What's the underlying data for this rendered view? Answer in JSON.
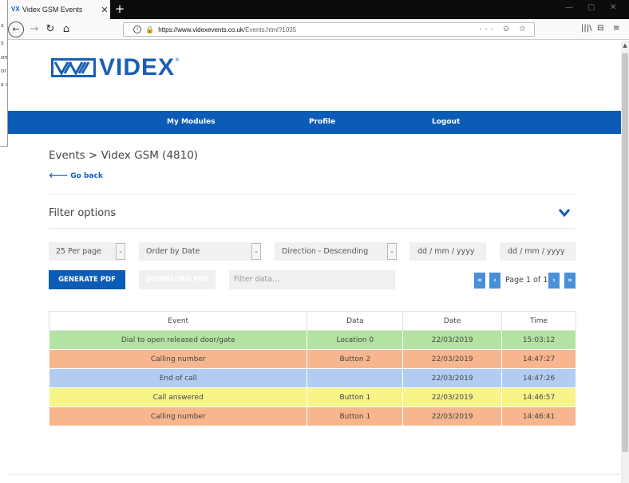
{
  "background_window": {
    "lines": [
      "s",
      "s",
      "on",
      "or",
      "s c"
    ]
  },
  "browser": {
    "tab_title": "Videx GSM Events",
    "tab_close": "✕",
    "new_tab": "+",
    "url_domain": "https://www.videxevents.co.uk",
    "url_path": "/Events.html?1035",
    "url_actions": "··· ☺ ☆",
    "library": "|||\\",
    "sidebar": "⊟",
    "menu": "≡",
    "window_controls": [
      "—",
      "▢",
      "✕"
    ]
  },
  "site": {
    "logo_text": "VIDEX",
    "logo_reg": "®"
  },
  "nav": {
    "items": [
      "My Modules",
      "Profile",
      "Logout"
    ]
  },
  "page": {
    "breadcrumb": "Events > Videx GSM (4810)",
    "go_back": "Go back",
    "filter_title": "Filter options"
  },
  "filters": {
    "per_page": "25 Per page",
    "order_by": "Order by Date",
    "direction": "Direction - Descending",
    "date_from_placeholder": "dd / mm / yyyy",
    "date_to_placeholder": "dd / mm / yyyy",
    "generate_pdf": "GENERATE PDF",
    "download_pdf": "DOWNLOAD PDF",
    "filter_placeholder": "Filter data..."
  },
  "pagination": {
    "first": "«",
    "prev": "‹",
    "label": "Page 1 of 1",
    "next": "›",
    "last": "»"
  },
  "table": {
    "headers": [
      "Event",
      "Data",
      "Date",
      "Time"
    ],
    "rows": [
      {
        "event": "Dial to open released door/gate",
        "data": "Location 0",
        "date": "22/03/2019",
        "time": "15:03:12",
        "color": "green"
      },
      {
        "event": "Calling number",
        "data": "Button 2",
        "date": "22/03/2019",
        "time": "14:47:27",
        "color": "orange"
      },
      {
        "event": "End of call",
        "data": "",
        "date": "22/03/2019",
        "time": "14:47:26",
        "color": "blue"
      },
      {
        "event": "Call answered",
        "data": "Button 1",
        "date": "22/03/2019",
        "time": "14:46:57",
        "color": "yellow"
      },
      {
        "event": "Calling number",
        "data": "Button 1",
        "date": "22/03/2019",
        "time": "14:46:41",
        "color": "orange"
      }
    ]
  },
  "colors": {
    "brand_blue": "#0b5cb7",
    "row_green": "#b3e3a2",
    "row_orange": "#f7b68e",
    "row_blue": "#b3cdf2",
    "row_yellow": "#f8f48a"
  }
}
